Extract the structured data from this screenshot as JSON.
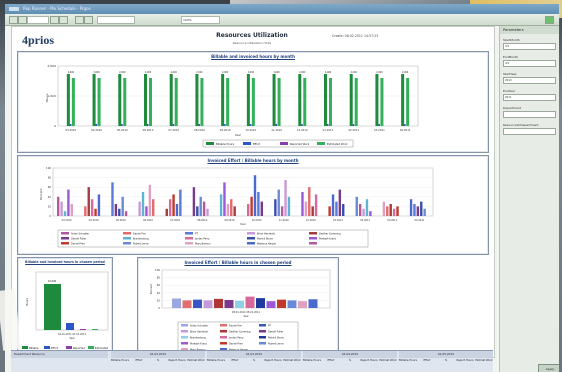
{
  "window": {
    "title": "Rep Runner - Mo Schedule - Prgos"
  },
  "toolbar": {
    "zoom": "100%",
    "page_label": "Midway"
  },
  "report": {
    "title": "Resources Utilization",
    "subtitle": "Resource Utilization Hints",
    "date": "Create: 08.02.2011 14:57:23",
    "logo_main": "prios",
    "logo_prefix": "4"
  },
  "chart1": {
    "title": "Billable and invoiced hours by month",
    "xlabel": "Year",
    "ylabel": "Hours",
    "months": [
      "03.2010",
      "04.2010",
      "05.2010",
      "06.2010",
      "07.2010",
      "08.2010",
      "09.2010",
      "10.2010",
      "11.2010",
      "12.2010",
      "01.2011",
      "02.2011",
      "03.2011",
      "04.2011"
    ],
    "y_ticks": [
      "2,000",
      "1,000",
      "0"
    ],
    "legend": [
      "Billable Hours",
      "Effort",
      "Reported Work",
      "Estimated Work"
    ],
    "colors": [
      "#1d8a3c",
      "#2c55c8",
      "#8a3fa8",
      "#34b05a"
    ]
  },
  "chart2": {
    "title": "Invoiced Effort / Billable hours by month",
    "xlabel": "Year",
    "ylabel": "Percent",
    "y_ticks": [
      "100",
      "80",
      "60",
      "40",
      "20",
      "0"
    ],
    "months": [
      "03.2010",
      "04.2010",
      "05.2010",
      "06.2010",
      "07.2010",
      "08.2010",
      "09.2010",
      "10.2010",
      "11.2010",
      "12.2010",
      "01.2011",
      "02.2011",
      "03.2011",
      "04.2011"
    ],
    "legend": [
      "Aidan Schuster",
      "Daniel Fire",
      "PT",
      "Brian Hardwick",
      "Gerther Cumming",
      "Gerald Fuller",
      "Brandenburg",
      "Jordan Perry",
      "Patrick Stone",
      "Prakash Kraut",
      "Daniel Prim",
      "Robert Lenon",
      "Mary Benson",
      "Rebecca Harper",
      ""
    ]
  },
  "chart3": {
    "title": "Billable and invoiced hours in chosen period",
    "xlabel": "Year",
    "ylabel": "Hours",
    "x_tick": "02.01.2011 01.01.2011",
    "value_label": "22,000",
    "legend": [
      "Billable",
      "Effort",
      "Reported",
      "Estimated"
    ]
  },
  "chart4": {
    "title": "Invoiced Effort / Billable hours in chosen period",
    "xlabel": "Year",
    "ylabel": "Percent",
    "x_tick": "08.01.2011 08.01.2011",
    "y_ticks": [
      "100",
      "80",
      "60",
      "40",
      "20",
      "0"
    ],
    "legend": [
      "Aidan Schuster",
      "Daniel Fire",
      "PT",
      "Brian Hardwick",
      "Gerther Cumming",
      "Gerald Fuller",
      "Brandenburg",
      "Jordan Perry",
      "Patrick Stone",
      "Prakash Kraut",
      "Daniel Prim",
      "Robert Lenon",
      "Mary Benson",
      "Rebecca Harper"
    ]
  },
  "sidebar": {
    "header": "Parameters",
    "fields": [
      {
        "label": "StartMonth",
        "value": "3/1"
      },
      {
        "label": "EndMonth",
        "value": "4/1"
      },
      {
        "label": "StartYear",
        "value": "2010"
      },
      {
        "label": "EndYear",
        "value": "2011"
      },
      {
        "label": "Department",
        "value": ""
      },
      {
        "label": "ResourceOrDepartment",
        "value": ""
      }
    ],
    "apply_button": "Apply"
  },
  "table": {
    "header": "Department Resource",
    "groups": [
      "01.02.2010",
      "01.03.2010",
      "01.04.2010",
      "01.05.2010"
    ],
    "cols": [
      "Billable Hours",
      "Effort",
      "%",
      "Report Hours",
      "Estimat Work"
    ]
  }
}
